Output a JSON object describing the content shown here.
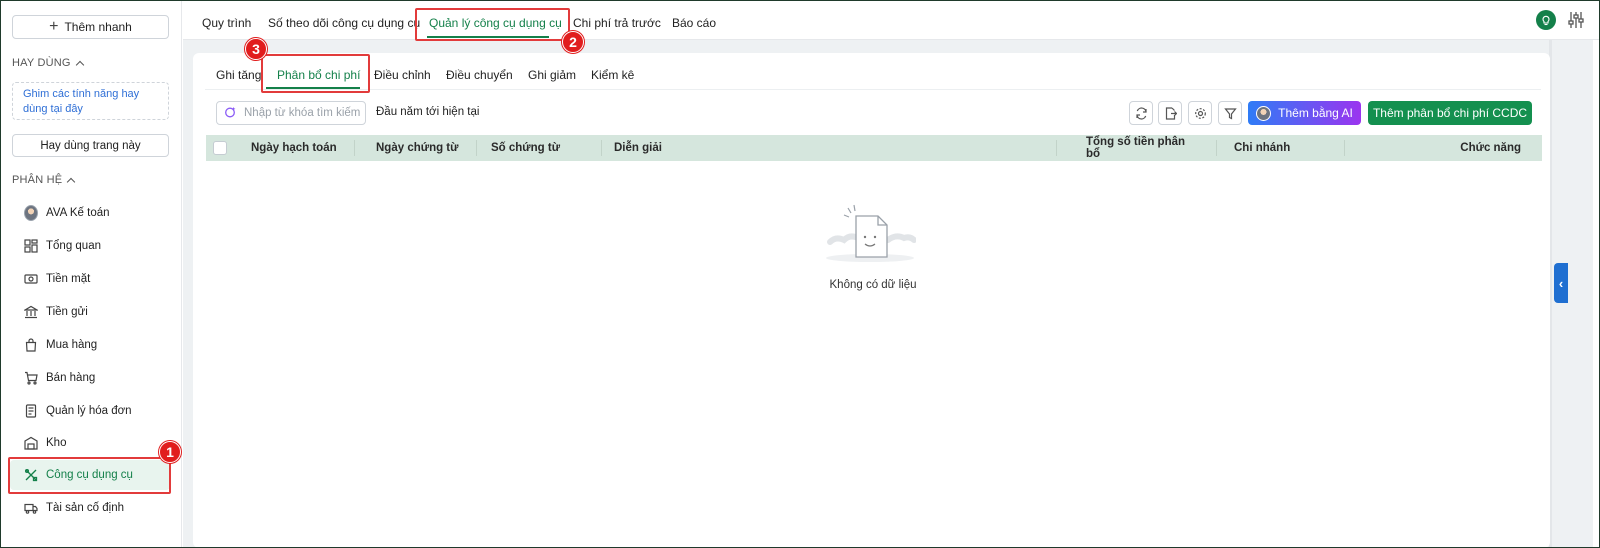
{
  "sidebar": {
    "quick_add_label": "Thêm nhanh",
    "favorites_title": "HAY DÙNG",
    "pin_hint": "Ghim các tính năng hay dùng tại đây",
    "favorite_page_button": "Hay dùng trang này",
    "modules_title": "PHÂN HỆ",
    "items": [
      {
        "label": "AVA Kế toán",
        "icon": "avatar-icon"
      },
      {
        "label": "Tổng quan",
        "icon": "grid-icon"
      },
      {
        "label": "Tiền mặt",
        "icon": "cash-icon"
      },
      {
        "label": "Tiền gửi",
        "icon": "bank-icon"
      },
      {
        "label": "Mua hàng",
        "icon": "shopping-bag-icon"
      },
      {
        "label": "Bán hàng",
        "icon": "cart-icon"
      },
      {
        "label": "Quản lý hóa đơn",
        "icon": "invoice-icon"
      },
      {
        "label": "Kho",
        "icon": "warehouse-icon"
      },
      {
        "label": "Công cụ dụng cụ",
        "icon": "tools-icon",
        "active": true
      },
      {
        "label": "Tài sản cố định",
        "icon": "truck-icon"
      }
    ]
  },
  "top_tabs": [
    {
      "label": "Quy trình"
    },
    {
      "label": "Số theo dõi công cụ dụng cụ"
    },
    {
      "label": "Quản lý công cụ dụng cụ",
      "active": true
    },
    {
      "label": "Chi phí trả trước"
    },
    {
      "label": "Báo cáo"
    }
  ],
  "sub_tabs": [
    {
      "label": "Ghi tăng"
    },
    {
      "label": "Phân bổ chi phí",
      "active": true
    },
    {
      "label": "Điều chỉnh"
    },
    {
      "label": "Điều chuyển"
    },
    {
      "label": "Ghi giảm"
    },
    {
      "label": "Kiểm kê"
    }
  ],
  "toolbar": {
    "search_placeholder": "Nhập từ khóa tìm kiếm",
    "period_label": "Đầu năm tới hiện tại",
    "ai_button_label": "Thêm bằng AI",
    "add_button_label": "Thêm phân bổ chi phí CCDC"
  },
  "table": {
    "columns": [
      "Ngày hạch toán",
      "Ngày chứng từ",
      "Số chứng từ",
      "Diễn giải",
      "Tổng số tiền phân bổ",
      "Chi nhánh",
      "Chức năng"
    ],
    "rows": [],
    "empty_text": "Không có dữ liệu"
  },
  "callouts": [
    "1",
    "2",
    "3"
  ],
  "colors": {
    "accent": "#14804a",
    "primary_button": "#14904f",
    "table_header": "#d5e6dd",
    "highlight": "#e23b3b",
    "ai_gradient_start": "#2f7cf6",
    "ai_gradient_end": "#9b34ef"
  }
}
